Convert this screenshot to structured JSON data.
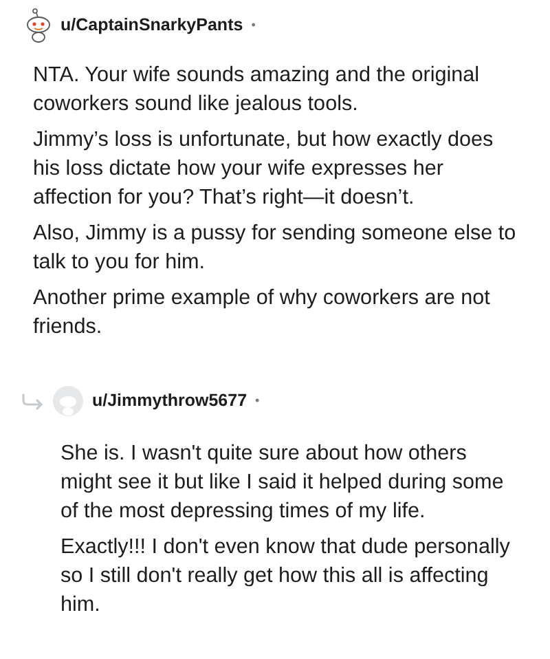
{
  "comments": [
    {
      "kind": "top",
      "author": "u/CaptainSnarkyPants",
      "separator": "•",
      "paragraphs": [
        "NTA. Your wife sounds amazing and the original coworkers sound like jealous tools.",
        "Jimmy’s loss is unfortunate, but how exactly does his loss dictate how your wife expresses her affection for you? That’s right—it doesn’t.",
        "Also, Jimmy is a pussy for sending someone else to talk to you for him.",
        "Another prime example of why coworkers are not friends."
      ]
    },
    {
      "kind": "reply",
      "author": "u/Jimmythrow5677",
      "separator": "•",
      "paragraphs": [
        "She is. I wasn't quite sure about how others might see it but like I said it helped during some of the most depressing times of my life.",
        "Exactly!!! I don't even know that dude personally so I still don't really get how this all is affecting him."
      ]
    }
  ]
}
